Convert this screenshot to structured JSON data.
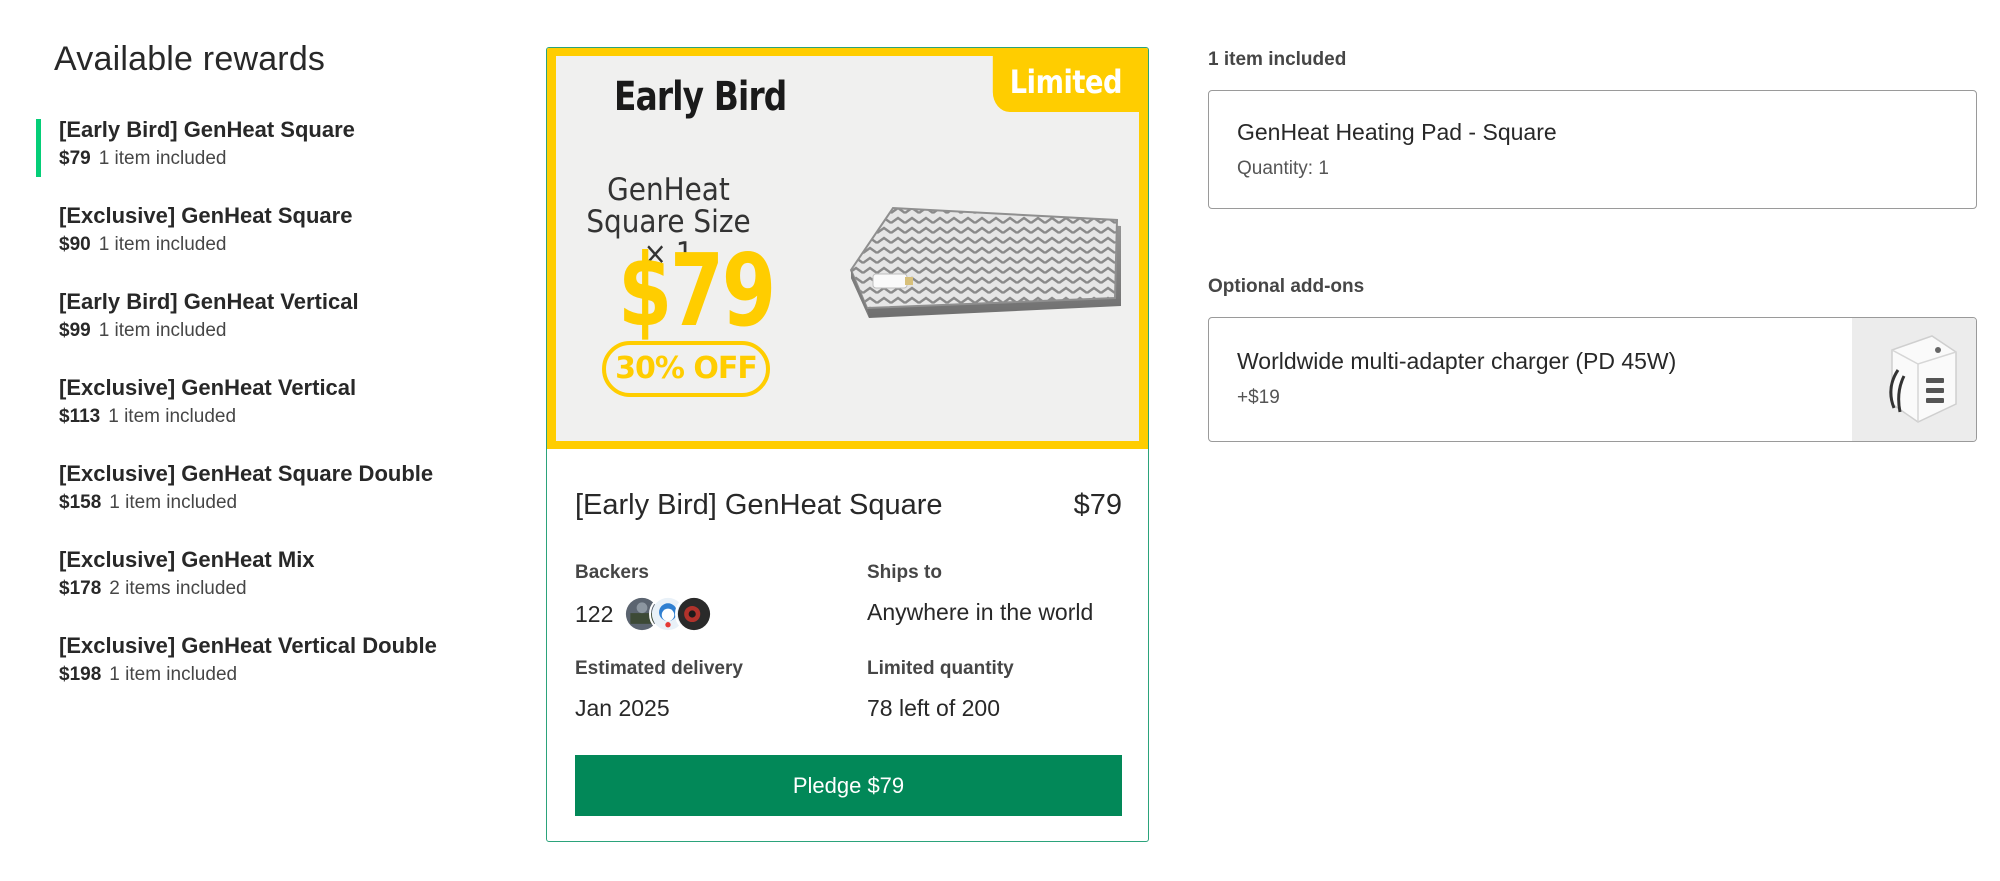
{
  "sidebar": {
    "title": "Available rewards",
    "items": [
      {
        "name": "[Early Bird] GenHeat Square",
        "price": "$79",
        "included": "1 item included"
      },
      {
        "name": "[Exclusive] GenHeat Square",
        "price": "$90",
        "included": "1 item included"
      },
      {
        "name": "[Early Bird] GenHeat Vertical",
        "price": "$99",
        "included": "1 item included"
      },
      {
        "name": "[Exclusive] GenHeat Vertical",
        "price": "$113",
        "included": "1 item included"
      },
      {
        "name": "[Exclusive] GenHeat Square Double",
        "price": "$158",
        "included": "1 item included"
      },
      {
        "name": "[Exclusive] GenHeat Mix",
        "price": "$178",
        "included": "2 items included"
      },
      {
        "name": "[Exclusive] GenHeat Vertical Double",
        "price": "$198",
        "included": "1 item included"
      }
    ]
  },
  "promo": {
    "badge": "Limited",
    "logo_text": "Early Bird",
    "product_line1": "GenHeat",
    "product_line2": "Square Size × 1",
    "price": "$79",
    "discount": "30% OFF"
  },
  "card": {
    "title": "[Early Bird] GenHeat Square",
    "price": "$79",
    "backers_label": "Backers",
    "backers_count": "122",
    "ships_label": "Ships to",
    "ships_value": "Anywhere in the world",
    "delivery_label": "Estimated delivery",
    "delivery_value": "Jan 2025",
    "quantity_label": "Limited quantity",
    "quantity_value": "78 left of 200",
    "pledge_label": "Pledge $79"
  },
  "included": {
    "label": "1 item included",
    "item_title": "GenHeat Heating Pad - Square",
    "item_quantity": "Quantity: 1"
  },
  "addons": {
    "label": "Optional add-ons",
    "item_title": "Worldwide multi-adapter charger (PD 45W)",
    "item_price": "+$19"
  },
  "colors": {
    "accent_green": "#05ce78",
    "button_green": "#028858",
    "promo_yellow": "#ffcd00"
  }
}
